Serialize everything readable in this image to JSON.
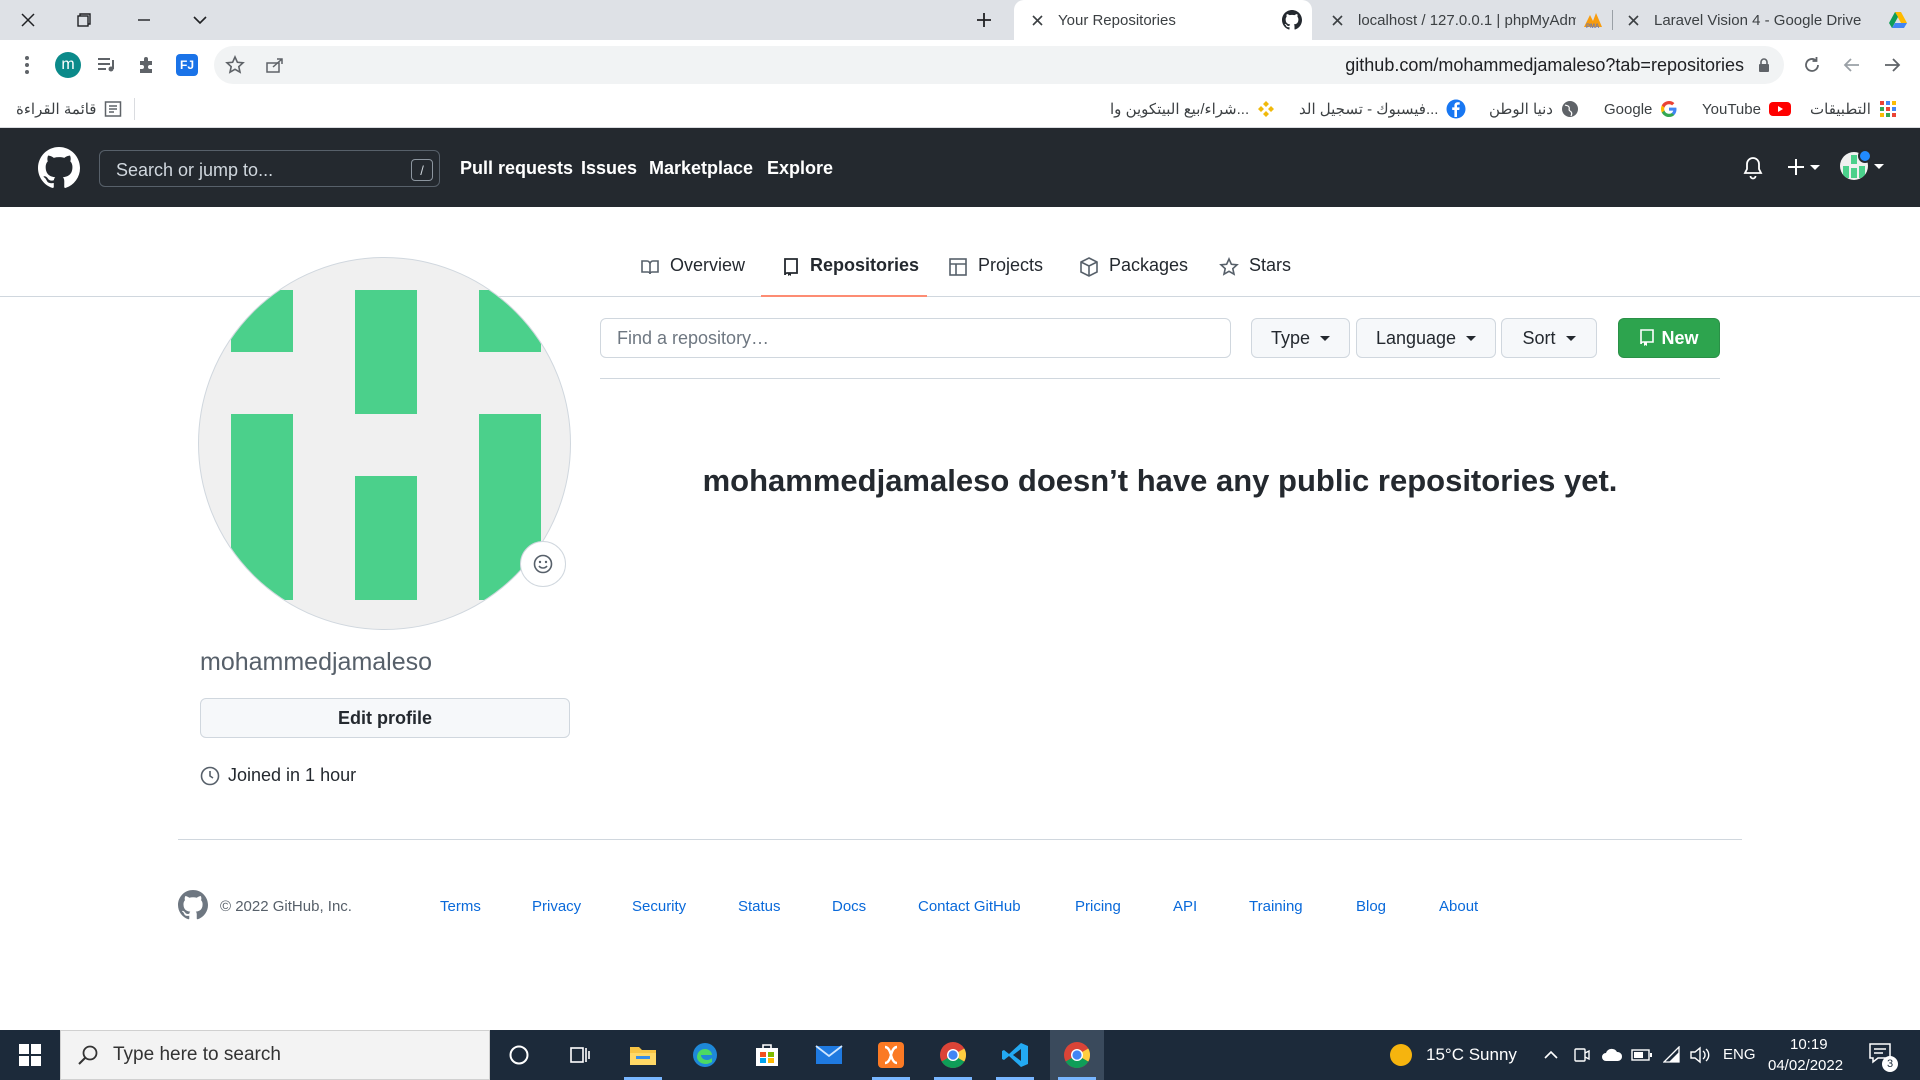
{
  "browser": {
    "tabs": [
      {
        "title": "Your Repositories",
        "active": true
      },
      {
        "title": "localhost / 127.0.0.1 | phpMyAdm",
        "active": false
      },
      {
        "title": "Laravel Vision 4 - Google Drive",
        "active": false
      }
    ],
    "url": "github.com/mohammedjamaleso?tab=repositories",
    "profile_initial": "m",
    "extension_label": "FJ",
    "bookmarks": {
      "reading_list": "قائمة القراءة",
      "apps": "التطبيقات",
      "youtube": "YouTube",
      "google": "Google",
      "donia": "دنيا الوطن",
      "facebook": "فيسبوك - تسجيل الد...",
      "binance": "شراء/بيع البيتكوين وا..."
    }
  },
  "github": {
    "search_placeholder": "Search or jump to...",
    "search_shortcut": "/",
    "nav": {
      "pull_requests": "Pull requests",
      "issues": "Issues",
      "marketplace": "Marketplace",
      "explore": "Explore"
    },
    "profile_tabs": {
      "overview": "Overview",
      "repositories": "Repositories",
      "projects": "Projects",
      "packages": "Packages",
      "stars": "Stars"
    },
    "username": "mohammedjamaleso",
    "edit_profile": "Edit profile",
    "joined": "Joined in 1 hour",
    "find_placeholder": "Find a repository…",
    "filters": {
      "type": "Type",
      "language": "Language",
      "sort": "Sort"
    },
    "new_button": "New",
    "empty_message": "mohammedjamaleso doesn’t have any public repositories yet.",
    "footer": {
      "copyright": "© 2022 GitHub, Inc.",
      "links": [
        "Terms",
        "Privacy",
        "Security",
        "Status",
        "Docs",
        "Contact GitHub",
        "Pricing",
        "API",
        "Training",
        "Blog",
        "About"
      ]
    }
  },
  "taskbar": {
    "search_placeholder": "Type here to search",
    "weather": "15°C  Sunny",
    "language": "ENG",
    "time": "10:19",
    "date": "04/02/2022",
    "notification_count": "3"
  },
  "colors": {
    "header_bg": "#24292f",
    "new_button_green": "#2da44e",
    "identicon_green": "#4bd08b",
    "tab_underline": "#fd8c73"
  }
}
